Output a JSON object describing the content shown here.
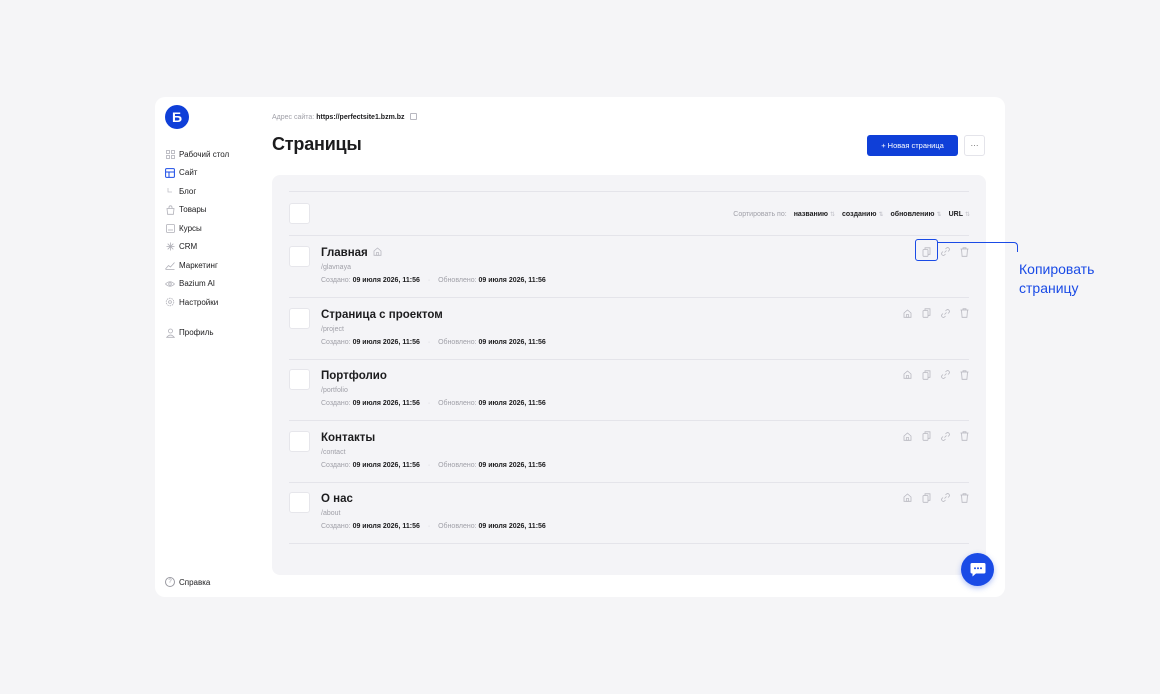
{
  "logo": {
    "letter": "Б"
  },
  "sidebar": {
    "items": [
      {
        "label": "Рабочий стол",
        "icon": "grid-icon"
      },
      {
        "label": "Сайт",
        "icon": "layout-icon",
        "active": true
      },
      {
        "label": "Блог",
        "icon": "sub-arrow-icon"
      },
      {
        "label": "Товары",
        "icon": "bag-icon"
      },
      {
        "label": "Курсы",
        "icon": "book-icon"
      },
      {
        "label": "CRM",
        "icon": "asterisk-icon"
      },
      {
        "label": "Маркетинг",
        "icon": "chart-icon"
      },
      {
        "label": "Bazium AI",
        "icon": "ai-icon"
      },
      {
        "label": "Настройки",
        "icon": "gear-icon"
      }
    ],
    "profile": "Профиль",
    "help": "Справка"
  },
  "header": {
    "address_label": "Адрес сайта:",
    "address_url": "https://perfectsite1.bzm.bz",
    "title": "Страницы",
    "new_page_button": "+ Новая страница",
    "more_button": "···"
  },
  "sort": {
    "label": "Сортировать по:",
    "options": [
      "названию",
      "созданию",
      "обновлению",
      "URL"
    ]
  },
  "pages": [
    {
      "name": "Главная",
      "path": "/glavnaya",
      "created_label": "Создано:",
      "created": "09 июля 2026, 11:56",
      "updated_label": "Обновлено:",
      "updated": "09 июля 2026, 11:56",
      "is_home": true
    },
    {
      "name": "Страница с проектом",
      "path": "/project",
      "created_label": "Создано:",
      "created": "09 июля 2026, 11:56",
      "updated_label": "Обновлено:",
      "updated": "09 июля 2026, 11:56",
      "is_home": false
    },
    {
      "name": "Портфолио",
      "path": "/portfolio",
      "created_label": "Создано:",
      "created": "09 июля 2026, 11:56",
      "updated_label": "Обновлено:",
      "updated": "09 июля 2026, 11:56",
      "is_home": false
    },
    {
      "name": "Контакты",
      "path": "/contact",
      "created_label": "Создано:",
      "created": "09 июля 2026, 11:56",
      "updated_label": "Обновлено:",
      "updated": "09 июля 2026, 11:56",
      "is_home": false
    },
    {
      "name": "О нас",
      "path": "/about",
      "created_label": "Создано:",
      "created": "09 июля 2026, 11:56",
      "updated_label": "Обновлено:",
      "updated": "09 июля 2026, 11:56",
      "is_home": false
    }
  ],
  "callout": {
    "line1": "Копировать",
    "line2": "страницу"
  },
  "colors": {
    "accent": "#1a4be6",
    "button": "#0f3fd8",
    "panel": "#f4f4f7",
    "muted": "#a0a0a8"
  }
}
